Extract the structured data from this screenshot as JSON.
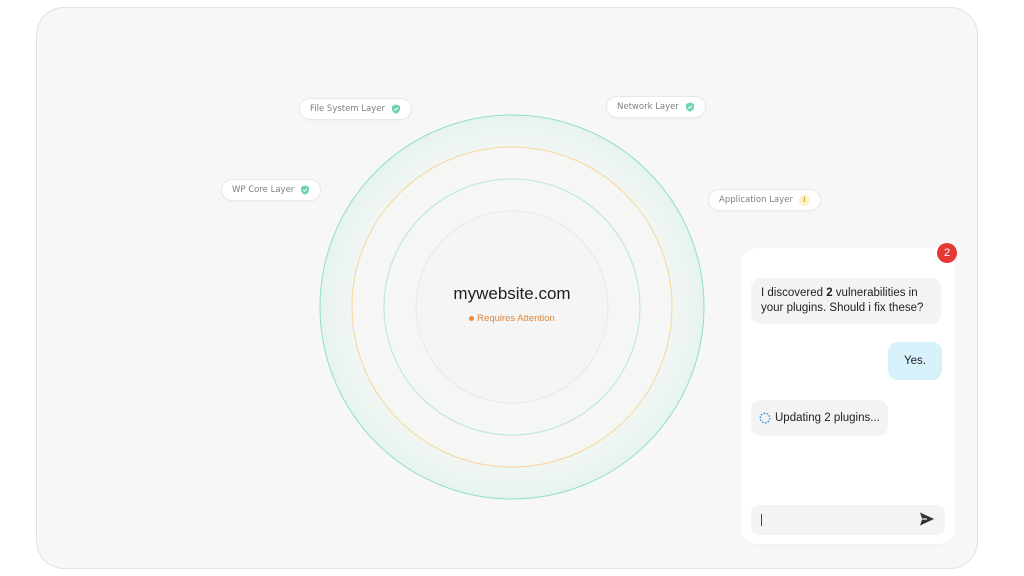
{
  "site": {
    "domain": "mywebsite.com",
    "status": "Requires Attention"
  },
  "layers": [
    {
      "label": "File System Layer",
      "state": "secure",
      "icon": "shield-check-icon"
    },
    {
      "label": "Network Layer",
      "state": "secure",
      "icon": "shield-check-icon"
    },
    {
      "label": "WP Core Layer",
      "state": "secure",
      "icon": "shield-check-icon"
    },
    {
      "label": "Application Layer",
      "state": "warning",
      "icon": "warning-icon",
      "badge": "!"
    }
  ],
  "chat": {
    "notification_count": "2",
    "messages": {
      "bot1_pre": "I discovered ",
      "bot1_bold": "2",
      "bot1_post": " vulnerabilities in your plugins. Should i fix these?",
      "user1": "Yes.",
      "bot2": "Updating 2 plugins..."
    },
    "input": {
      "value": "",
      "placeholder": ""
    }
  },
  "colors": {
    "secure": "#6fd3ae",
    "warning": "#f3c978",
    "status": "#e0873a",
    "badge": "#e53935",
    "user_bubble": "#d6f1fa"
  }
}
